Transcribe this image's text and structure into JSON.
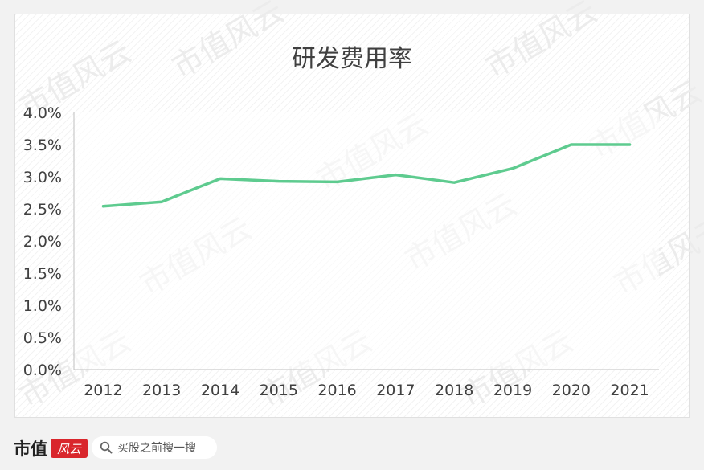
{
  "chart_data": {
    "type": "line",
    "title": "研发费用率",
    "categories": [
      "2012",
      "2013",
      "2014",
      "2015",
      "2016",
      "2017",
      "2018",
      "2019",
      "2020",
      "2021"
    ],
    "series": [
      {
        "values": [
          2.54,
          2.61,
          2.97,
          2.93,
          2.92,
          3.03,
          2.91,
          3.13,
          3.5,
          3.5
        ]
      }
    ],
    "y_tick_labels": [
      "0.0%",
      "0.5%",
      "1.0%",
      "1.5%",
      "2.0%",
      "2.5%",
      "3.0%",
      "3.5%",
      "4.0%"
    ],
    "ylim": [
      0,
      4.0
    ],
    "y_unit": "%",
    "grid": false,
    "legend": "none",
    "line_color": "#5ecb8f"
  },
  "watermark": "市值风云",
  "footer": {
    "brand": "市值",
    "brand_seal": "风云",
    "search_text": "买股之前搜一搜"
  }
}
